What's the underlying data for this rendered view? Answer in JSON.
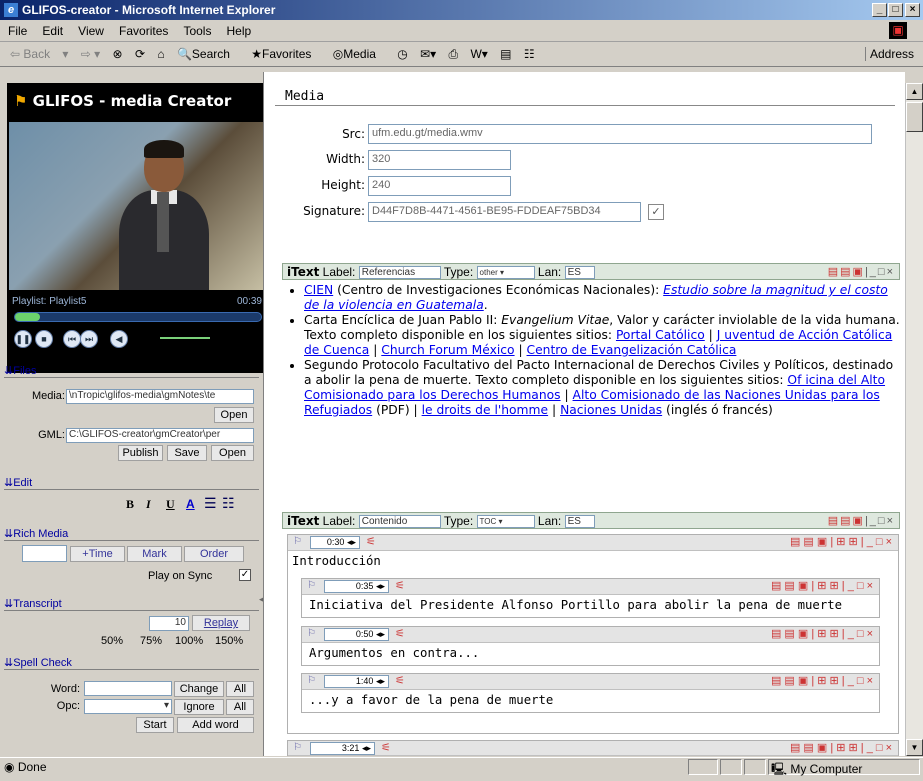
{
  "window": {
    "title": "GLIFOS-creator - Microsoft Internet Explorer"
  },
  "menu": [
    "File",
    "Edit",
    "View",
    "Favorites",
    "Tools",
    "Help"
  ],
  "toolbar": {
    "back": "Back",
    "search": "Search",
    "favorites": "Favorites",
    "media": "Media",
    "address": "Address"
  },
  "player": {
    "logo_prefix": "GLIFOS",
    "logo_suffix": "- media Creator",
    "playlist": "Playlist: Playlist5",
    "time": "00:39",
    "seek_progress": 0.1
  },
  "files": {
    "header": "Files",
    "media_label": "Media:",
    "media_value": "\\nTropic\\glifos-media\\gmNotes\\te",
    "open": "Open",
    "gml_label": "GML:",
    "gml_value": "C:\\GLIFOS-creator\\gmCreator\\per",
    "publish": "Publish",
    "save": "Save",
    "open2": "Open"
  },
  "edit": {
    "header": "Edit",
    "bold": "B",
    "italic": "I",
    "underline": "U",
    "color": "A"
  },
  "rich_media": {
    "header": "Rich Media",
    "time": "+Time",
    "mark": "Mark",
    "order": "Order",
    "play_on_sync": "Play on Sync"
  },
  "transcript": {
    "header": "Transcript",
    "value": "10",
    "replay": "Replay",
    "speeds": [
      "50%",
      "75%",
      "100%",
      "150%"
    ]
  },
  "spell": {
    "header": "Spell Check",
    "word_label": "Word:",
    "opc_label": "Opc:",
    "change": "Change",
    "all": "All",
    "ignore": "Ignore",
    "all2": "All",
    "start": "Start",
    "add_word": "Add word"
  },
  "media": {
    "header": "Media",
    "src_label": "Src:",
    "src": "ufm.edu.gt/media.wmv",
    "width_label": "Width:",
    "width": "320",
    "height_label": "Height:",
    "height": "240",
    "sig_label": "Signature:",
    "signature": "D44F7D8B-4471-4561-BE95-FDDEAF75BD34"
  },
  "itext1": {
    "title": "iText",
    "label_label": "Label:",
    "label": "Referencias",
    "type_label": "Type:",
    "type": "other",
    "lan_label": "Lan:",
    "lan": "ES"
  },
  "refs": {
    "b1": {
      "link1": "CIEN",
      "text1": " (Centro de Investigaciones Económicas Nacionales): ",
      "link2": "Estudio sobre la magnitud y el costo de la violencia en Guatemala",
      "end": "."
    },
    "b2": {
      "text1": "Carta Encíclica de Juan Pablo II: ",
      "italic": "Evangelium Vitae",
      "text2": ", Valor y carácter inviolable de la vida humana. Texto completo disponible en los siguientes sitios: ",
      "l1": "Portal Católico",
      "sep": " | ",
      "l2": "J uventud de Acción Católica de Cuenca",
      "l3": "Church Forum México",
      "l4": "Centro de Evangelización Católica"
    },
    "b3": {
      "text1": "Segundo Protocolo Facultativo del Pacto Internacional de Derechos Civiles y Políticos, destinado a abolir la pena de muerte. Texto completo disponible en los siguientes sitios: ",
      "l1": "Of icina del Alto Comisionado para los Derechos Humanos",
      "l2": "Alto Comisionado de las Naciones Unidas para los Refugiados",
      "pdf": " (PDF) | ",
      "l3": "le droits de l'homme",
      "l4": "Naciones Unidas",
      "end": " (inglés ó francés)"
    }
  },
  "itext2": {
    "title": "iText",
    "label_label": "Label:",
    "label": "Contenido",
    "type_label": "Type:",
    "type": "TOC",
    "lan_label": "Lan:",
    "lan": "ES"
  },
  "nodes": [
    {
      "time": "0:30",
      "text": "Introducción"
    },
    {
      "time": "0:35",
      "text": "Iniciativa del Presidente Alfonso Portillo para abolir la pena de muerte"
    },
    {
      "time": "0:50",
      "text": "Argumentos en contra..."
    },
    {
      "time": "1:40",
      "text": "...y a favor de la pena de muerte"
    },
    {
      "time": "3:21",
      "text": ""
    }
  ],
  "status": {
    "left": "Done",
    "zone": "My Computer"
  }
}
